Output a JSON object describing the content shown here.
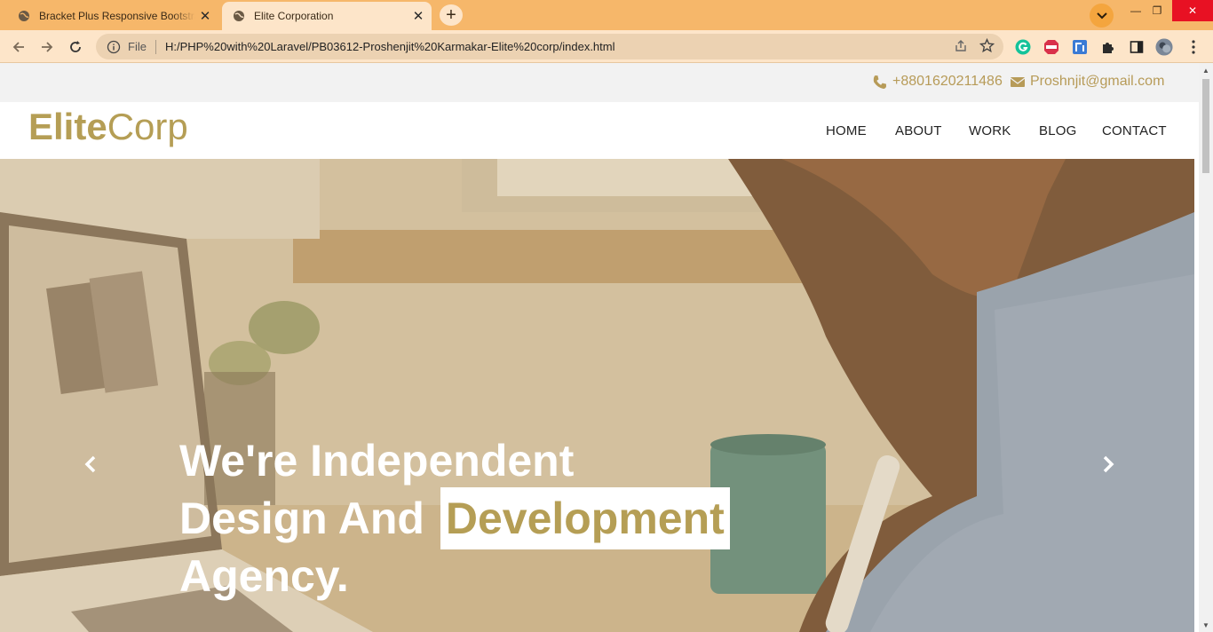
{
  "browser": {
    "tabs": [
      {
        "title": "Bracket Plus Responsive Bootstrap",
        "active": false
      },
      {
        "title": "Elite Corporation",
        "active": true
      }
    ],
    "url_scheme": "File",
    "url": "H:/PHP%20with%20Laravel/PB03612-Proshenjit%20Karmakar-Elite%20corp/index.html",
    "theme_color": "#f6b76a"
  },
  "site": {
    "contact": {
      "phone": "+8801620211486",
      "email": "Proshnjit@gmail.com"
    },
    "logo": {
      "bold": "Elite",
      "light": "Corp"
    },
    "menu": [
      "HOME",
      "ABOUT",
      "WORK",
      "BLOG",
      "CONTACT"
    ],
    "hero": {
      "line1": "We're Independent",
      "line2_prefix": "Design And",
      "line2_highlight": "Development",
      "line3": "Agency."
    },
    "accent_color": "#b59e55"
  }
}
